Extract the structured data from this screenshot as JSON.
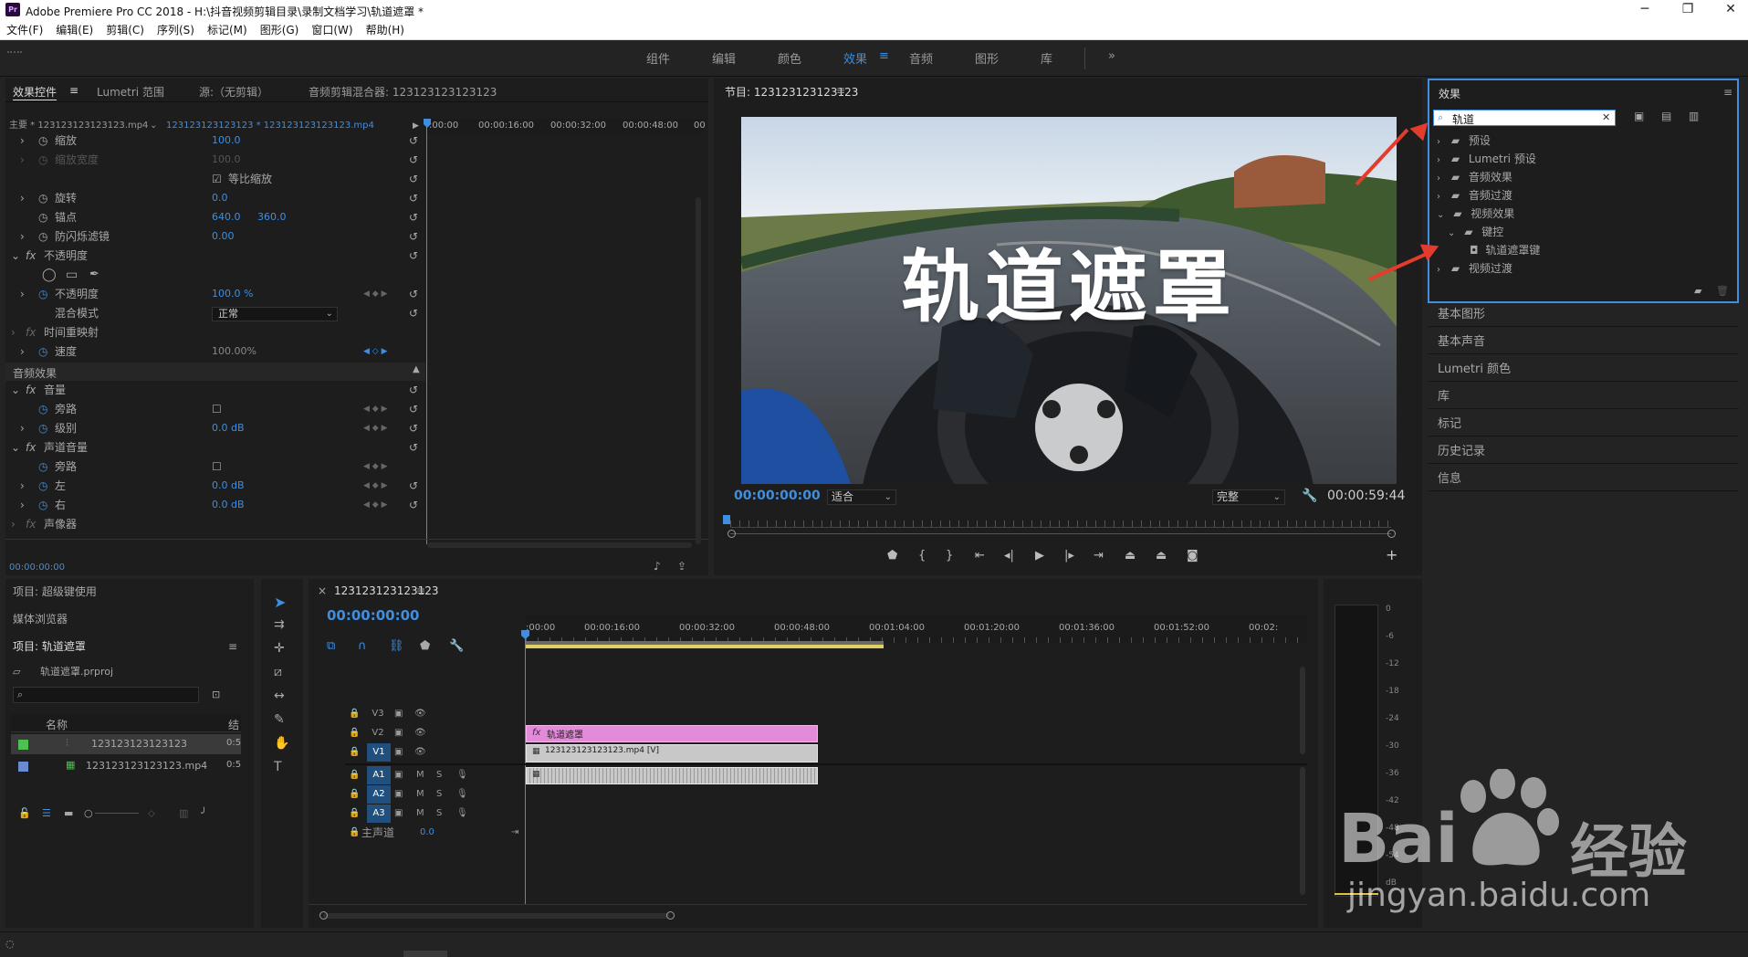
{
  "window": {
    "app_icon": "Pr",
    "title": "Adobe Premiere Pro CC 2018 - H:\\抖音视频剪辑目录\\录制文档学习\\轨道遮罩 *",
    "minimize": "─",
    "maximize": "❐",
    "close": "✕"
  },
  "menu": [
    "文件(F)",
    "编辑(E)",
    "剪辑(C)",
    "序列(S)",
    "标记(M)",
    "图形(G)",
    "窗口(W)",
    "帮助(H)"
  ],
  "workspaces": {
    "items": [
      "组件",
      "编辑",
      "颜色",
      "效果",
      "音频",
      "图形",
      "库"
    ],
    "active": "效果",
    "more": "»",
    "menu_icon": "≡"
  },
  "effect_controls": {
    "tabs": [
      "效果控件",
      "Lumetri 范围",
      "源:（无剪辑）",
      "音频剪辑混合器: 123123123123123"
    ],
    "tab_menu": "≡",
    "master": "主要 * 123123123123123.mp4",
    "seq": "123123123123123 * 123123123123123.mp4",
    "ruler": [
      ":00:00",
      "00:00:16:00",
      "00:00:32:00",
      "00:00:48:00",
      "00"
    ],
    "rows": {
      "scale": {
        "label": "缩放",
        "value": "100.0"
      },
      "scale_w": {
        "label": "缩放宽度",
        "value": "100.0"
      },
      "uniform": "等比缩放",
      "rotation": {
        "label": "旋转",
        "value": "0.0"
      },
      "anchor": {
        "label": "锚点",
        "v1": "640.0",
        "v2": "360.0"
      },
      "flicker": {
        "label": "防闪烁滤镜",
        "value": "0.00"
      },
      "opacity_hdr": "不透明度",
      "opacity": {
        "label": "不透明度",
        "value": "100.0 %"
      },
      "blend": {
        "label": "混合模式",
        "value": "正常"
      },
      "timeremap": "时间重映射",
      "speed": {
        "label": "速度",
        "value": "100.00%"
      },
      "audio_fx": "音频效果",
      "volume": "音量",
      "bypass1": "旁路",
      "level": {
        "label": "级别",
        "value": "0.0 dB"
      },
      "chvol": "声道音量",
      "bypass2": "旁路",
      "left": {
        "label": "左",
        "value": "0.0 dB"
      },
      "right": {
        "label": "右",
        "value": "0.0 dB"
      },
      "panner": "声像器"
    },
    "timecode": "00:00:00:00"
  },
  "program": {
    "title": "节目: 123123123123123",
    "menu": "≡",
    "overlay_text": "轨道遮罩",
    "timecode": "00:00:00:00",
    "fit": "适合",
    "quality": "完整",
    "duration": "00:00:59:44"
  },
  "project": {
    "tabs": [
      "项目: 超级键使用",
      "媒体浏览器",
      "项目: 轨道遮罩"
    ],
    "menu": "≡",
    "file": "轨道遮罩.prproj",
    "col_name": "名称",
    "col_rate": "结",
    "items": [
      {
        "name": "123123123123123",
        "dur": "0:5"
      },
      {
        "name": "123123123123123.mp4",
        "dur": "0:5"
      }
    ]
  },
  "timeline": {
    "tab": "123123123123123",
    "close": "×",
    "menu": "≡",
    "timecode": "00:00:00:00",
    "ruler": [
      ":00:00",
      "00:00:16:00",
      "00:00:32:00",
      "00:00:48:00",
      "00:01:04:00",
      "00:01:20:00",
      "00:01:36:00",
      "00:01:52:00",
      "00:02:"
    ],
    "tracks_v": [
      "V3",
      "V2",
      "V1"
    ],
    "tracks_a": [
      "A1",
      "A2",
      "A3"
    ],
    "master": "主声道",
    "master_val": "0.0",
    "clip_v2": "轨道遮罩",
    "clip_v1": "123123123123123.mp4 [V]",
    "m": "M",
    "s": "S"
  },
  "meter": {
    "scale": [
      "0",
      "-6",
      "-12",
      "-18",
      "-24",
      "-30",
      "-36",
      "-42",
      "-48",
      "-54",
      "dB"
    ]
  },
  "effects": {
    "title": "效果",
    "menu": "≡",
    "search": "轨道",
    "tree": [
      {
        "label": "预设",
        "level": 0
      },
      {
        "label": "Lumetri 预设",
        "level": 0
      },
      {
        "label": "音频效果",
        "level": 0
      },
      {
        "label": "音频过渡",
        "level": 0
      },
      {
        "label": "视频效果",
        "level": 0,
        "open": true
      },
      {
        "label": "键控",
        "level": 1,
        "open": true
      },
      {
        "label": "轨道遮罩键",
        "level": 2
      },
      {
        "label": "视频过渡",
        "level": 0
      }
    ]
  },
  "side_panels": [
    "基本图形",
    "基本声音",
    "Lumetri 颜色",
    "库",
    "标记",
    "历史记录",
    "信息"
  ],
  "watermark": {
    "brand": "Bai",
    "brand2": "经验",
    "url": "jingyan.baidu.com"
  },
  "colors": {
    "accent": "#3f8ee0",
    "clip_pink": "#e38ad9",
    "clip_gray": "#c8c8c8",
    "arrow": "#e53b2c",
    "playhead": "#3f8ee0"
  }
}
